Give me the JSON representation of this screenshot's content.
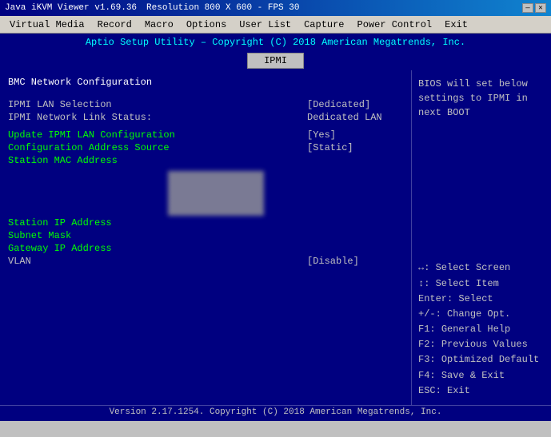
{
  "titlebar": {
    "title": "Java iKVM Viewer v1.69.36",
    "resolution": "Resolution 800 X 600 - FPS 30",
    "minimize": "—",
    "close": "✕"
  },
  "menubar": {
    "items": [
      "Virtual Media",
      "Record",
      "Macro",
      "Options",
      "User List",
      "Capture",
      "Power Control",
      "Exit"
    ]
  },
  "bios": {
    "header": "Aptio Setup Utility – Copyright (C) 2018 American Megatrends, Inc.",
    "tab": "IPMI",
    "left": {
      "section_title": "BMC Network Configuration",
      "rows": [
        {
          "label": "IPMI LAN Selection",
          "value": "[Dedicated]",
          "highlight": false
        },
        {
          "label": "IPMI Network Link Status:",
          "value": "Dedicated LAN",
          "highlight": false
        },
        {
          "label": "",
          "value": "",
          "highlight": false
        },
        {
          "label": "Update IPMI LAN Configuration",
          "value": "[Yes]",
          "highlight": true
        },
        {
          "label": "Configuration Address Source",
          "value": "[Static]",
          "highlight": true
        },
        {
          "label": "Station MAC Address",
          "value": "",
          "highlight": true
        },
        {
          "label": "Station IP Address",
          "value": "",
          "highlight": true
        },
        {
          "label": "Subnet Mask",
          "value": "",
          "highlight": true
        },
        {
          "label": "Gateway IP Address",
          "value": "",
          "highlight": true
        },
        {
          "label": "VLAN",
          "value": "[Disable]",
          "highlight": false
        }
      ]
    },
    "right": {
      "top_text": "BIOS will set below settings to IPMI in next BOOT",
      "help_items": [
        {
          "key": "↔:",
          "desc": "Select Screen"
        },
        {
          "key": "↕:",
          "desc": "Select Item"
        },
        {
          "key": "Enter:",
          "desc": "Select"
        },
        {
          "key": "+/-:",
          "desc": "Change Opt."
        },
        {
          "key": "F1:",
          "desc": "General Help"
        },
        {
          "key": "F2:",
          "desc": "Previous Values"
        },
        {
          "key": "F3:",
          "desc": "Optimized Default"
        },
        {
          "key": "F4:",
          "desc": "Save & Exit"
        },
        {
          "key": "ESC:",
          "desc": "Exit"
        }
      ]
    },
    "footer": "Version 2.17.1254. Copyright (C) 2018 American Megatrends, Inc."
  }
}
